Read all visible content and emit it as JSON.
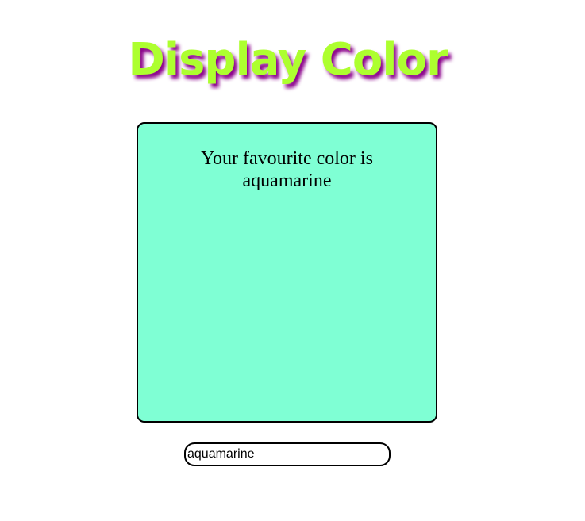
{
  "header": {
    "title": "Display Color"
  },
  "display": {
    "message_prefix": "Your favourite color is",
    "color_name": "aquamarine",
    "background_color": "#7fffd4"
  },
  "input": {
    "value": "aquamarine"
  },
  "colors": {
    "title_fill": "#adff2f",
    "title_shadow": "#8b008b"
  }
}
